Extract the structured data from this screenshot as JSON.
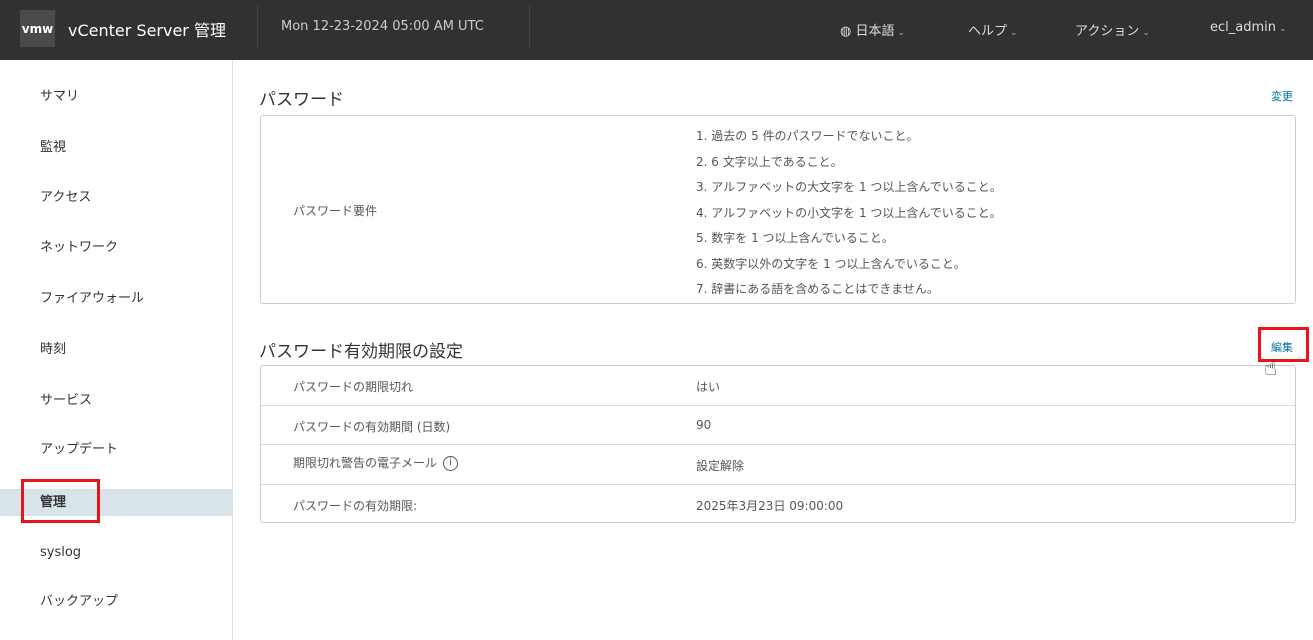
{
  "header": {
    "logo": "vmw",
    "title": "vCenter Server 管理",
    "datetime": "Mon 12-23-2024 05:00 AM UTC",
    "language": "日本語",
    "help": "ヘルプ",
    "actions": "アクション",
    "user": "ecl_admin"
  },
  "sidebar": {
    "items": [
      "サマリ",
      "監視",
      "アクセス",
      "ネットワーク",
      "ファイアウォール",
      "時刻",
      "サービス",
      "アップデート",
      "管理",
      "syslog",
      "バックアップ"
    ],
    "active": "管理"
  },
  "password": {
    "title": "パスワード",
    "change": "変更",
    "requirements_label": "パスワード要件",
    "requirements": [
      "1. 過去の 5 件のパスワードでないこと。",
      "2. 6 文字以上であること。",
      "3. アルファベットの大文字を 1 つ以上含んでいること。",
      "4. アルファベットの小文字を 1 つ以上含んでいること。",
      "5. 数字を 1 つ以上含んでいること。",
      "6. 英数字以外の文字を 1 つ以上含んでいること。",
      "7. 辞書にある語を含めることはできません。"
    ]
  },
  "expiry": {
    "title": "パスワード有効期限の設定",
    "edit": "編集",
    "rows": [
      {
        "label": "パスワードの期限切れ",
        "value": "はい"
      },
      {
        "label": "パスワードの有効期間 (日数)",
        "value": "90"
      },
      {
        "label": "期限切れ警告の電子メール",
        "value": "設定解除"
      },
      {
        "label": "パスワードの有効期限:",
        "value": "2025年3月23日 09:00:00"
      }
    ]
  }
}
